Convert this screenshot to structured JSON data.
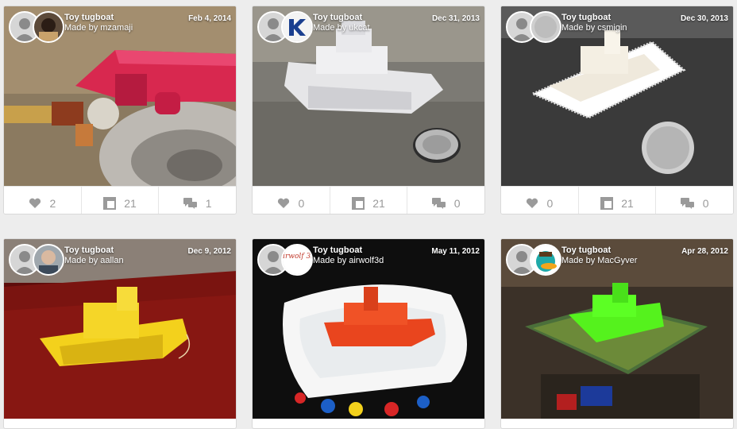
{
  "cards": [
    {
      "title": "Toy tugboat",
      "maker": "Made by mzamaji",
      "date": "Feb 4, 2014",
      "likes": "2",
      "views": "21",
      "comments": "1"
    },
    {
      "title": "Toy tugboat",
      "maker": "Made by ukcat",
      "date": "Dec 31, 2013",
      "likes": "0",
      "views": "21",
      "comments": "0"
    },
    {
      "title": "Toy tugboat",
      "maker": "Made by csmigin",
      "date": "Dec 30, 2013",
      "likes": "0",
      "views": "21",
      "comments": "0"
    },
    {
      "title": "Toy tugboat",
      "maker": "Made by aallan",
      "date": "Dec 9, 2012"
    },
    {
      "title": "Toy tugboat",
      "maker": "Made by airwolf3d",
      "date": "May 11, 2012",
      "avatar_text": "Airwolf 3D"
    },
    {
      "title": "Toy tugboat",
      "maker": "Made by MacGyver",
      "date": "Apr 28, 2012"
    }
  ],
  "icons": {
    "like": "heart-icon",
    "views": "layout-icon",
    "comments": "speech-bubbles-icon",
    "avatar": "user-silhouette-icon"
  },
  "colors": {
    "stat_text": "#9a9a9a",
    "card_border": "#d9d9d9",
    "background": "#ededed"
  }
}
